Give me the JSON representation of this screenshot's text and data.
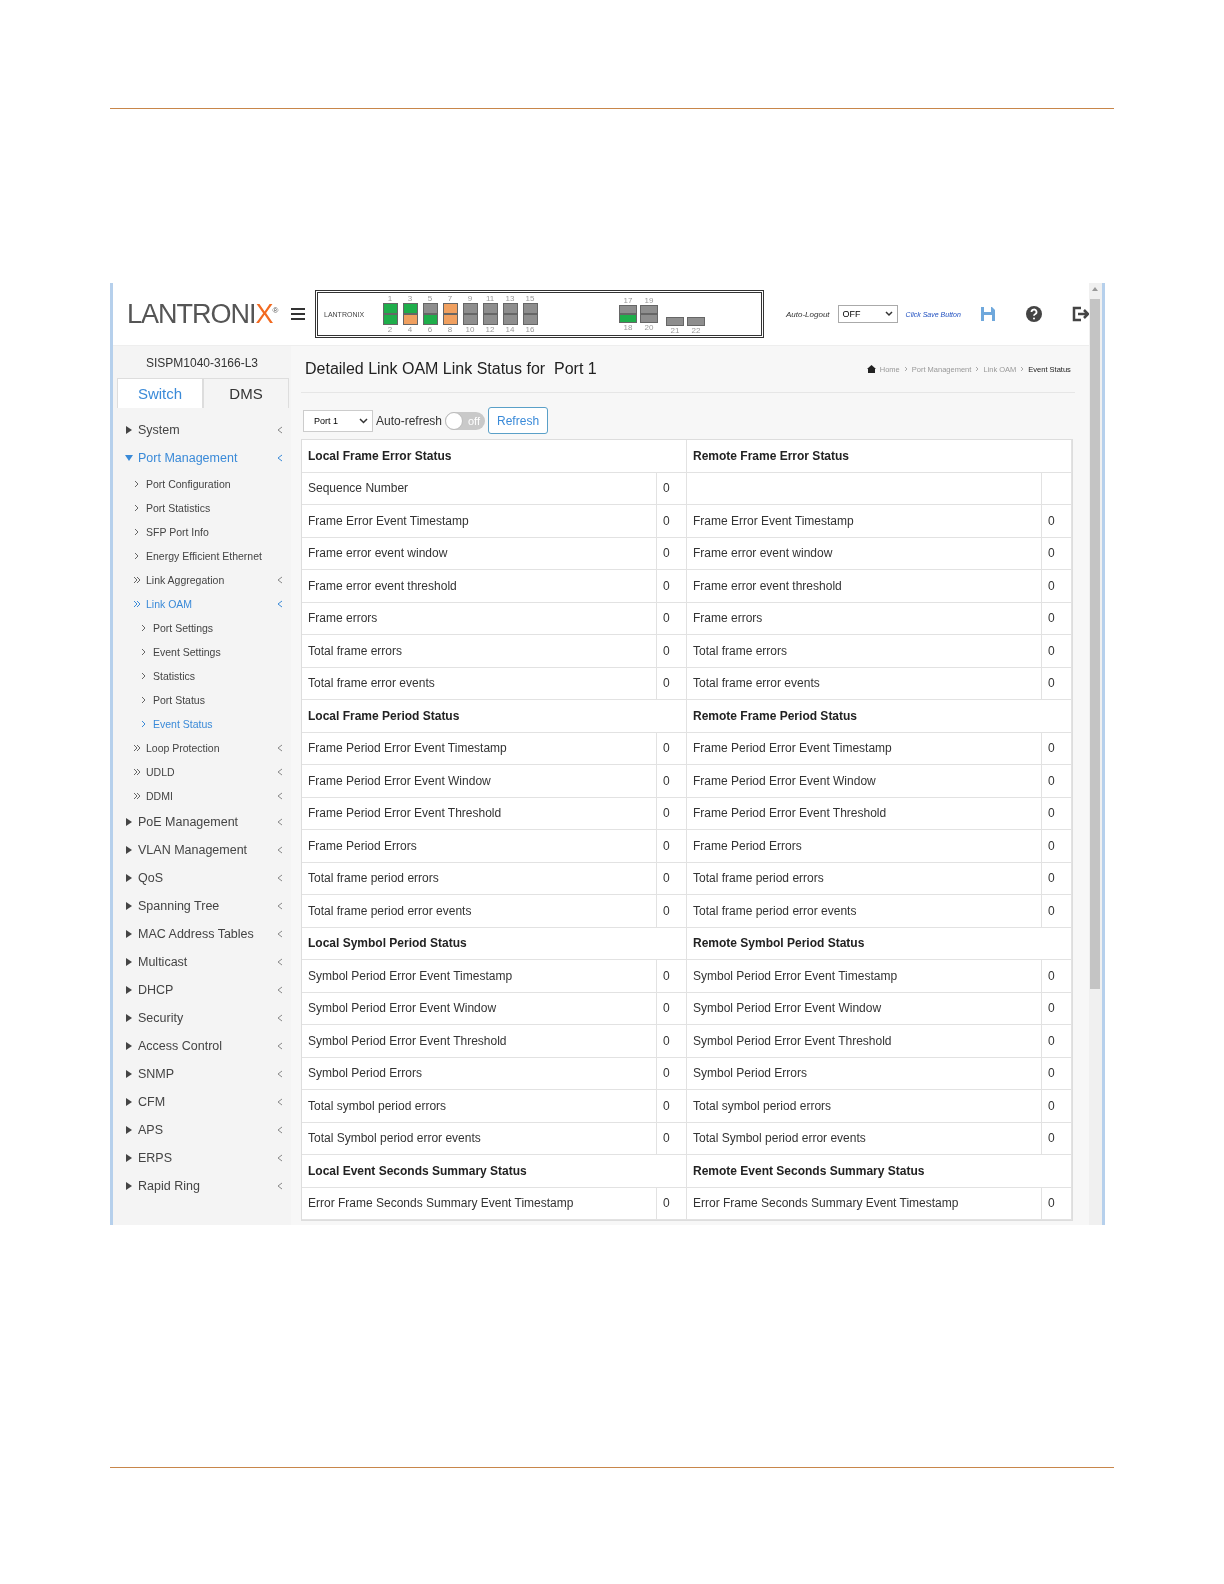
{
  "header": {
    "logo": {
      "main": "LANTRONI",
      "accent": "X",
      "mark": "®"
    },
    "device_panel": {
      "logo": "LANTRONIX",
      "port_groups": [
        {
          "kind": "rj45",
          "columns": [
            {
              "upper": {
                "label": "1",
                "color": "#1fae4b"
              },
              "lower": {
                "label": "2",
                "color": "#1fae4b"
              }
            },
            {
              "upper": {
                "label": "3",
                "color": "#1fae4b"
              },
              "lower": {
                "label": "4",
                "color": "#f0a060"
              }
            },
            {
              "upper": {
                "label": "5",
                "color": "#8e8e8e"
              },
              "lower": {
                "label": "6",
                "color": "#1fae4b"
              }
            },
            {
              "upper": {
                "label": "7",
                "color": "#f0a060"
              },
              "lower": {
                "label": "8",
                "color": "#f0a060"
              }
            },
            {
              "upper": {
                "label": "9",
                "color": "#8e8e8e"
              },
              "lower": {
                "label": "10",
                "color": "#8e8e8e"
              }
            },
            {
              "upper": {
                "label": "11",
                "color": "#8e8e8e"
              },
              "lower": {
                "label": "12",
                "color": "#8e8e8e"
              }
            },
            {
              "upper": {
                "label": "13",
                "color": "#8e8e8e"
              },
              "lower": {
                "label": "14",
                "color": "#8e8e8e"
              }
            },
            {
              "upper": {
                "label": "15",
                "color": "#8e8e8e"
              },
              "lower": {
                "label": "16",
                "color": "#8e8e8e"
              }
            }
          ]
        },
        {
          "kind": "combo",
          "columns": [
            {
              "upper": {
                "label": "17",
                "color": "#8e8e8e"
              },
              "lower": {
                "label": "18",
                "color": "#1fae4b"
              }
            },
            {
              "upper": {
                "label": "19",
                "color": "#8e8e8e"
              },
              "lower": {
                "label": "20",
                "color": "#8e8e8e"
              }
            }
          ]
        },
        {
          "kind": "sfp",
          "columns": [
            {
              "lower": {
                "label": "21",
                "color": "#8e8e8e"
              }
            },
            {
              "lower": {
                "label": "22",
                "color": "#8e8e8e"
              }
            }
          ]
        }
      ]
    },
    "auto_logout_label": "Auto-Logout",
    "auto_logout_value": "OFF",
    "save_link": "Click Save Button"
  },
  "sidebar": {
    "device_name": "SISPM1040-3166-L3",
    "tabs": [
      {
        "label": "Switch",
        "selected": true
      },
      {
        "label": "DMS",
        "selected": false
      }
    ],
    "items": [
      {
        "label": "System",
        "expanded": false,
        "selected": false
      },
      {
        "label": "Port Management",
        "expanded": true,
        "selected": true,
        "children": [
          {
            "label": "Port Configuration",
            "kind": "page",
            "selected": false
          },
          {
            "label": "Port Statistics",
            "kind": "page",
            "selected": false
          },
          {
            "label": "SFP Port Info",
            "kind": "page",
            "selected": false
          },
          {
            "label": "Energy Efficient Ethernet",
            "kind": "page",
            "selected": false
          },
          {
            "label": "Link Aggregation",
            "kind": "folder",
            "selected": false
          },
          {
            "label": "Link OAM",
            "kind": "folder",
            "selected": true,
            "children": [
              {
                "label": "Port Settings",
                "selected": false
              },
              {
                "label": "Event Settings",
                "selected": false
              },
              {
                "label": "Statistics",
                "selected": false
              },
              {
                "label": "Port Status",
                "selected": false
              },
              {
                "label": "Event Status",
                "selected": true
              }
            ]
          },
          {
            "label": "Loop Protection",
            "kind": "folder",
            "selected": false
          },
          {
            "label": "UDLD",
            "kind": "folder",
            "selected": false
          },
          {
            "label": "DDMI",
            "kind": "folder",
            "selected": false
          }
        ]
      },
      {
        "label": "PoE Management",
        "expanded": false,
        "selected": false
      },
      {
        "label": "VLAN Management",
        "expanded": false,
        "selected": false
      },
      {
        "label": "QoS",
        "expanded": false,
        "selected": false
      },
      {
        "label": "Spanning Tree",
        "expanded": false,
        "selected": false
      },
      {
        "label": "MAC Address Tables",
        "expanded": false,
        "selected": false
      },
      {
        "label": "Multicast",
        "expanded": false,
        "selected": false
      },
      {
        "label": "DHCP",
        "expanded": false,
        "selected": false
      },
      {
        "label": "Security",
        "expanded": false,
        "selected": false
      },
      {
        "label": "Access Control",
        "expanded": false,
        "selected": false
      },
      {
        "label": "SNMP",
        "expanded": false,
        "selected": false
      },
      {
        "label": "CFM",
        "expanded": false,
        "selected": false
      },
      {
        "label": "APS",
        "expanded": false,
        "selected": false
      },
      {
        "label": "ERPS",
        "expanded": false,
        "selected": false
      },
      {
        "label": "Rapid Ring",
        "expanded": false,
        "selected": false
      }
    ]
  },
  "content": {
    "title": "Detailed Link OAM Link Status for  Port 1",
    "breadcrumb": [
      "Home",
      "Port Management",
      "Link OAM",
      "Event Status"
    ],
    "port_select": "Port 1",
    "auto_refresh_label": "Auto-refresh",
    "auto_refresh": {
      "on": false,
      "text": "off"
    },
    "refresh_button": "Refresh",
    "sections": [
      {
        "local_title": "Local Frame Error Status",
        "remote_title": "Remote Frame Error Status",
        "rows": [
          {
            "local_label": "Sequence Number",
            "local_value": "0"
          },
          {
            "local_label": "Frame Error Event Timestamp",
            "local_value": "0",
            "remote_label": "Frame Error Event Timestamp",
            "remote_value": "0"
          },
          {
            "local_label": "Frame error event window",
            "local_value": "0",
            "remote_label": "Frame error event window",
            "remote_value": "0"
          },
          {
            "local_label": "Frame error event threshold",
            "local_value": "0",
            "remote_label": "Frame error event threshold",
            "remote_value": "0"
          },
          {
            "local_label": "Frame errors",
            "local_value": "0",
            "remote_label": "Frame errors",
            "remote_value": "0"
          },
          {
            "local_label": "Total frame errors",
            "local_value": "0",
            "remote_label": "Total frame errors",
            "remote_value": "0"
          },
          {
            "local_label": "Total frame error events",
            "local_value": "0",
            "remote_label": "Total frame error events",
            "remote_value": "0"
          }
        ]
      },
      {
        "local_title": "Local Frame Period Status",
        "remote_title": "Remote Frame Period Status",
        "rows": [
          {
            "local_label": "Frame Period Error Event Timestamp",
            "local_value": "0",
            "remote_label": "Frame Period Error Event Timestamp",
            "remote_value": "0"
          },
          {
            "local_label": "Frame Period Error Event Window",
            "local_value": "0",
            "remote_label": "Frame Period Error Event Window",
            "remote_value": "0"
          },
          {
            "local_label": "Frame Period Error Event Threshold",
            "local_value": "0",
            "remote_label": "Frame Period Error Event Threshold",
            "remote_value": "0"
          },
          {
            "local_label": "Frame Period Errors",
            "local_value": "0",
            "remote_label": "Frame Period Errors",
            "remote_value": "0"
          },
          {
            "local_label": "Total frame period errors",
            "local_value": "0",
            "remote_label": "Total frame period errors",
            "remote_value": "0"
          },
          {
            "local_label": "Total frame period error events",
            "local_value": "0",
            "remote_label": "Total frame period error events",
            "remote_value": "0"
          }
        ]
      },
      {
        "local_title": "Local Symbol Period Status",
        "remote_title": "Remote Symbol Period Status",
        "rows": [
          {
            "local_label": "Symbol Period Error Event Timestamp",
            "local_value": "0",
            "remote_label": "Symbol Period Error Event Timestamp",
            "remote_value": "0"
          },
          {
            "local_label": "Symbol Period Error Event Window",
            "local_value": "0",
            "remote_label": "Symbol Period Error Event Window",
            "remote_value": "0"
          },
          {
            "local_label": "Symbol Period Error Event Threshold",
            "local_value": "0",
            "remote_label": "Symbol Period Error Event Threshold",
            "remote_value": "0"
          },
          {
            "local_label": "Symbol Period Errors",
            "local_value": "0",
            "remote_label": "Symbol Period Errors",
            "remote_value": "0"
          },
          {
            "local_label": "Total symbol period errors",
            "local_value": "0",
            "remote_label": "Total symbol period errors",
            "remote_value": "0"
          },
          {
            "local_label": "Total Symbol period error events",
            "local_value": "0",
            "remote_label": "Total Symbol period error events",
            "remote_value": "0"
          }
        ]
      },
      {
        "local_title": "Local Event Seconds Summary Status",
        "remote_title": "Remote Event Seconds Summary Status",
        "rows": [
          {
            "local_label": "Error Frame Seconds Summary Event Timestamp",
            "local_value": "0",
            "remote_label": "Error Frame Seconds Summary Event Timestamp",
            "remote_value": "0"
          }
        ]
      }
    ]
  }
}
